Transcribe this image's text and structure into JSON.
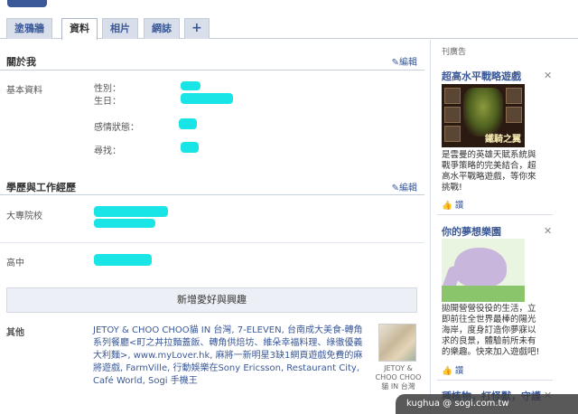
{
  "tabs": [
    {
      "label": "塗鴉牆"
    },
    {
      "label": "資料"
    },
    {
      "label": "相片"
    },
    {
      "label": "網誌"
    },
    {
      "label": "+"
    }
  ],
  "about": {
    "title": "關於我",
    "edit": "編輯",
    "basic_label": "基本資料",
    "fields": {
      "gender": "性別：",
      "birthday": "生日：",
      "relationship": "感情狀態：",
      "looking_for": "尋找："
    }
  },
  "education": {
    "title": "學歷與工作經歷",
    "edit": "編輯",
    "college_label": "大專院校",
    "highschool_label": "高中"
  },
  "add_interests": "新增愛好與興趣",
  "other": {
    "label": "其他",
    "text": "JETOY & CHOO CHOO貓 IN 台灣, 7-ELEVEN, 台南成大美食-轉角系列餐廳<町之丼拉麵蓋飯、轉角供焙坊、維朵幸福料理、綠徹優義大利麵>, www.myLover.hk, 麻將一新明星3缺1網頁遊戲免費的麻將遊戲, FarmVille, 行動娛樂在Sony Ericsson, Restaurant City, Café World, Sogi 手機王",
    "thumb_caption": "JETOY & CHOO CHOO貓 IN 台灣"
  },
  "sidebar": {
    "header": "刊廣告",
    "ads": [
      {
        "title": "超高水平戰略遊戲",
        "banner": "鐵騎之翼",
        "text": "是雲曼的英雄天賦系統與戰爭策略的完美結合，超高水平戰略遊戲，等你來挑戰!",
        "like": "讚"
      },
      {
        "title": "你的夢想樂園",
        "text": "拋開營營役役的生活，立即前往全世界最棒的陽光海岸，度身訂造你夢寐以求的良景，體驗前所未有的樂趣。快來加入遊戲吧!",
        "like": "讚"
      },
      {
        "title": "種植物，打怪獸，守護"
      }
    ]
  },
  "watermark": "kughua  @ sogi.com.tw",
  "colors": {
    "link": "#3b5998",
    "redaction": "#19e4e6",
    "tab_bg": "#d8dfea"
  }
}
